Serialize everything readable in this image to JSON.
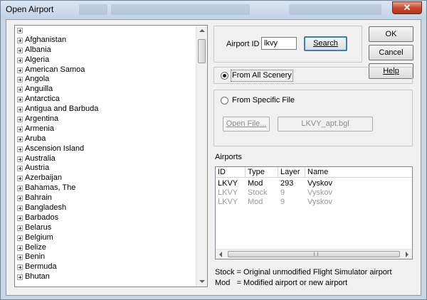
{
  "window": {
    "title": "Open Airport",
    "close_glyph": "✕"
  },
  "tree": {
    "root_label": "",
    "countries": [
      "Afghanistan",
      "Albania",
      "Algeria",
      "American Samoa",
      "Angola",
      "Anguilla",
      "Antarctica",
      "Antigua and Barbuda",
      "Argentina",
      "Armenia",
      "Aruba",
      "Ascension Island",
      "Australia",
      "Austria",
      "Azerbaijan",
      "Bahamas, The",
      "Bahrain",
      "Bangladesh",
      "Barbados",
      "Belarus",
      "Belgium",
      "Belize",
      "Benin",
      "Bermuda",
      "Bhutan"
    ]
  },
  "search": {
    "airport_id_label": "Airport ID",
    "airport_id_value": "lkvy",
    "search_button": "Search"
  },
  "buttons": {
    "ok": "OK",
    "cancel": "Cancel",
    "help": "Help"
  },
  "source": {
    "from_all_label": "From All Scenery",
    "from_specific_label": "From Specific File",
    "open_file_button": "Open File...",
    "file_name": "LKVY_apt.bgl",
    "selected": "all"
  },
  "airports": {
    "label": "Airports",
    "columns": [
      "ID",
      "Type",
      "Layer",
      "Name"
    ],
    "rows": [
      {
        "id": "LKVY",
        "type": "Mod",
        "layer": "293",
        "name": "Vyskov",
        "dim": false
      },
      {
        "id": "LKVY",
        "type": "Stock",
        "layer": "9",
        "name": "Vyskov",
        "dim": true
      },
      {
        "id": "LKVY",
        "type": "Mod",
        "layer": "9",
        "name": "Vyskov",
        "dim": true
      }
    ]
  },
  "legend": {
    "stock_line": "Stock = Original unmodified Flight Simulator airport",
    "mod_line": "Mod   = Modified airport or new airport"
  }
}
